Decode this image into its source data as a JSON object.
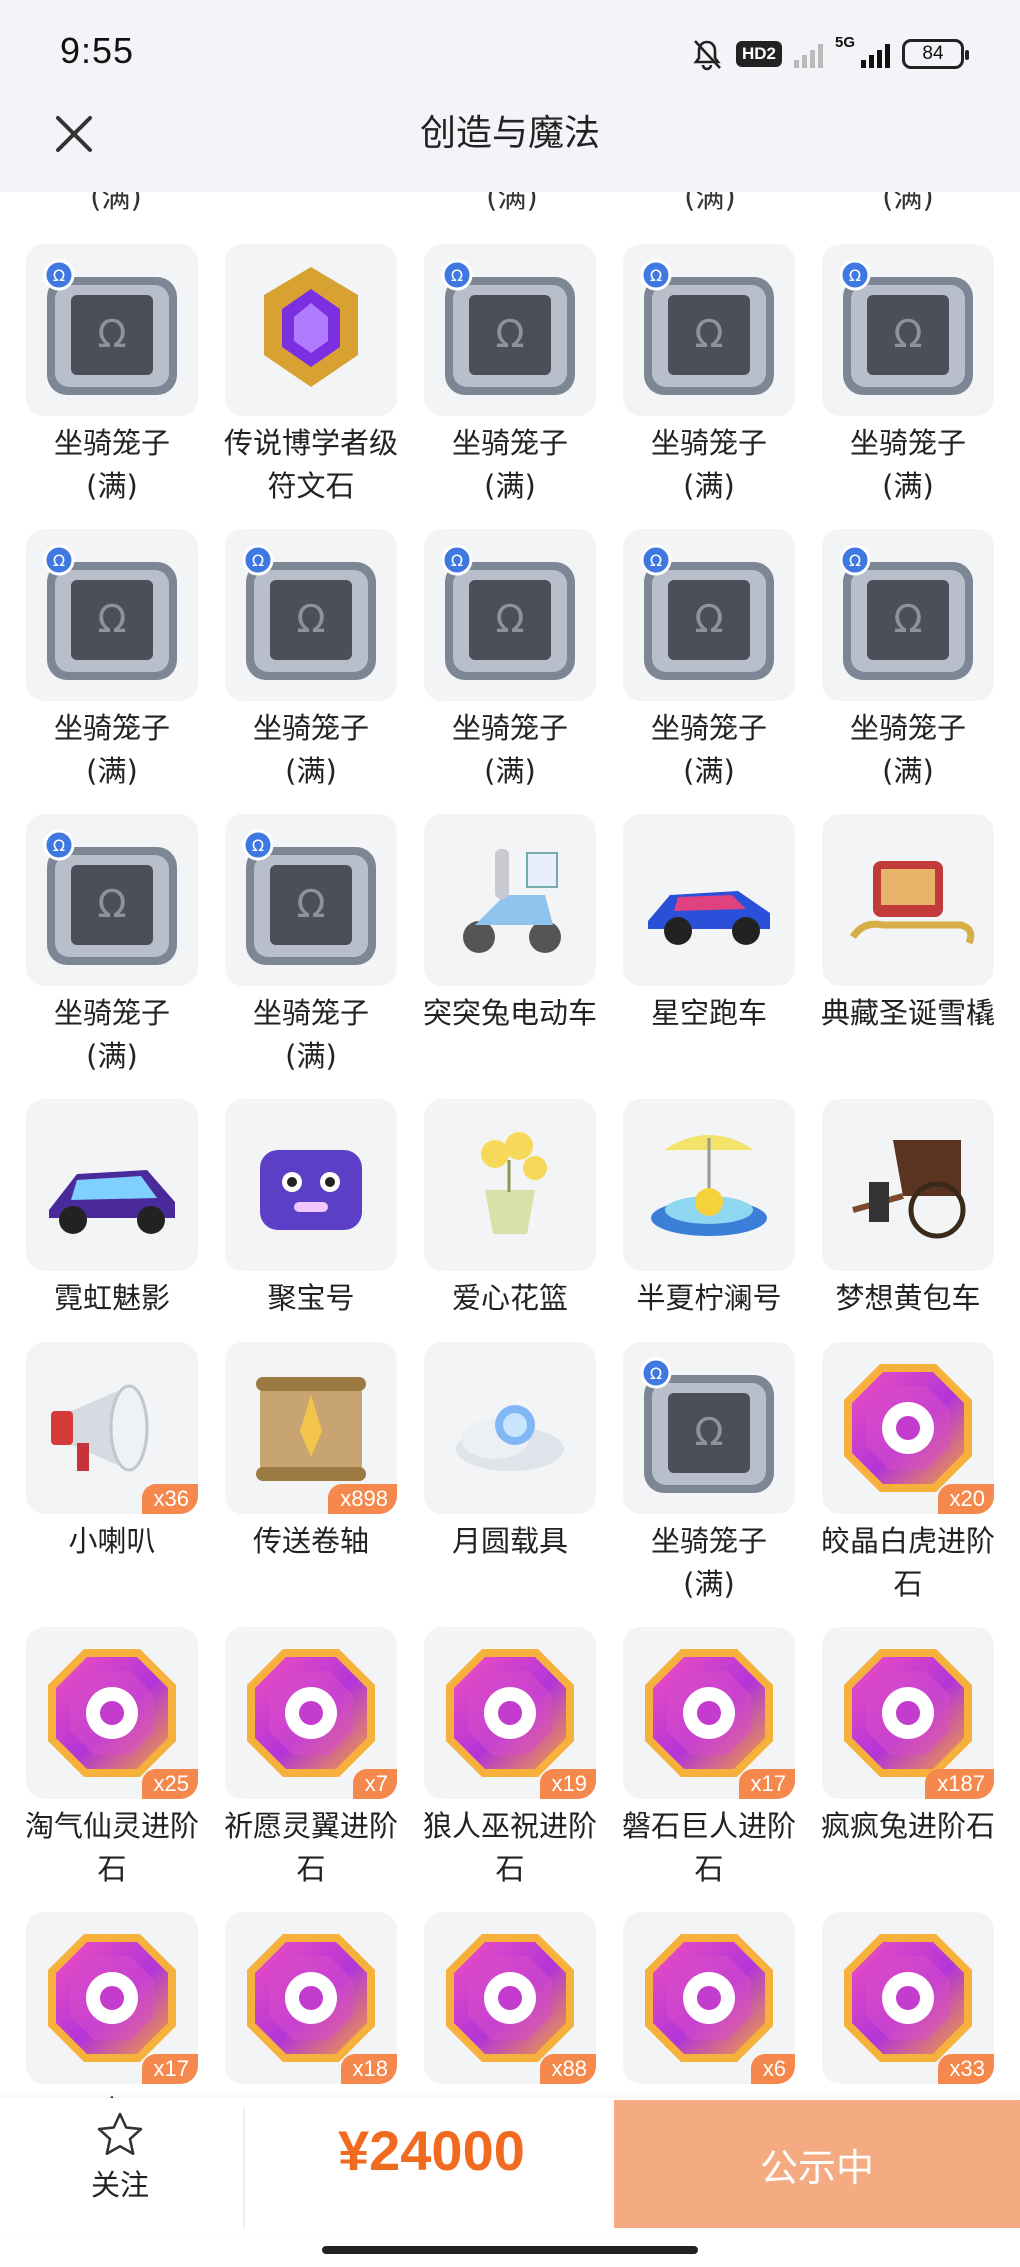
{
  "status_bar": {
    "time": "9:55",
    "hd_label": "HD2",
    "net_label": "5G",
    "battery": "84"
  },
  "header": {
    "title": "创造与魔法"
  },
  "partial_row": [
    "(满)",
    "(满)",
    "(满)",
    "(满)"
  ],
  "items": [
    {
      "icon": "cage",
      "name": "坐骑笼子\n(满)"
    },
    {
      "icon": "rune",
      "name": "传说博学者级符文石"
    },
    {
      "icon": "cage",
      "name": "坐骑笼子\n(满)"
    },
    {
      "icon": "cage",
      "name": "坐骑笼子\n(满)"
    },
    {
      "icon": "cage",
      "name": "坐骑笼子\n(满)"
    },
    {
      "icon": "cage",
      "name": "坐骑笼子\n(满)"
    },
    {
      "icon": "cage",
      "name": "坐骑笼子\n(满)"
    },
    {
      "icon": "cage",
      "name": "坐骑笼子\n(满)"
    },
    {
      "icon": "cage",
      "name": "坐骑笼子\n(满)"
    },
    {
      "icon": "cage",
      "name": "坐骑笼子\n(满)"
    },
    {
      "icon": "cage",
      "name": "坐骑笼子\n(满)"
    },
    {
      "icon": "cage",
      "name": "坐骑笼子\n(满)"
    },
    {
      "icon": "scooter",
      "name": "突突兔电动车"
    },
    {
      "icon": "sportscar",
      "name": "星空跑车"
    },
    {
      "icon": "sleigh",
      "name": "典藏圣诞雪橇"
    },
    {
      "icon": "neon",
      "name": "霓虹魅影"
    },
    {
      "icon": "treasure",
      "name": "聚宝号"
    },
    {
      "icon": "basket",
      "name": "爱心花篮"
    },
    {
      "icon": "lemon",
      "name": "半夏柠澜号"
    },
    {
      "icon": "rickshaw",
      "name": "梦想黄包车"
    },
    {
      "icon": "horn",
      "name": "小喇叭",
      "count": "x36"
    },
    {
      "icon": "scroll",
      "name": "传送卷轴",
      "count": "x898"
    },
    {
      "icon": "moon",
      "name": "月圆载具"
    },
    {
      "icon": "cage",
      "name": "坐骑笼子\n(满)"
    },
    {
      "icon": "gem-claw",
      "name": "皎晶白虎进阶石",
      "count": "x20"
    },
    {
      "icon": "gem-fairy",
      "name": "淘气仙灵进阶石",
      "count": "x25"
    },
    {
      "icon": "gem-wing",
      "name": "祈愿灵翼进阶石",
      "count": "x7"
    },
    {
      "icon": "gem-wolf",
      "name": "狼人巫祝进阶石",
      "count": "x19"
    },
    {
      "icon": "gem-giant",
      "name": "磐石巨人进阶石",
      "count": "x17"
    },
    {
      "icon": "gem-rabbit",
      "name": "疯疯兔进阶石",
      "count": "x187"
    },
    {
      "icon": "gem-dragon",
      "name": "毒",
      "count": "x17"
    },
    {
      "icon": "gem-dog",
      "name": "",
      "count": "x18"
    },
    {
      "icon": "gem-egg",
      "name": "",
      "count": "x88"
    },
    {
      "icon": "gem-bull",
      "name": "",
      "count": "x6"
    },
    {
      "icon": "gem-acorn",
      "name": "",
      "count": "x33"
    }
  ],
  "bottom_bar": {
    "follow_label": "关注",
    "price": "¥24000",
    "status_label": "公示中"
  },
  "colors": {
    "accent": "#f06a1f",
    "badge": "#f5894d",
    "status_button": "#f5ab82",
    "tile_bg": "#f3f4f6"
  }
}
